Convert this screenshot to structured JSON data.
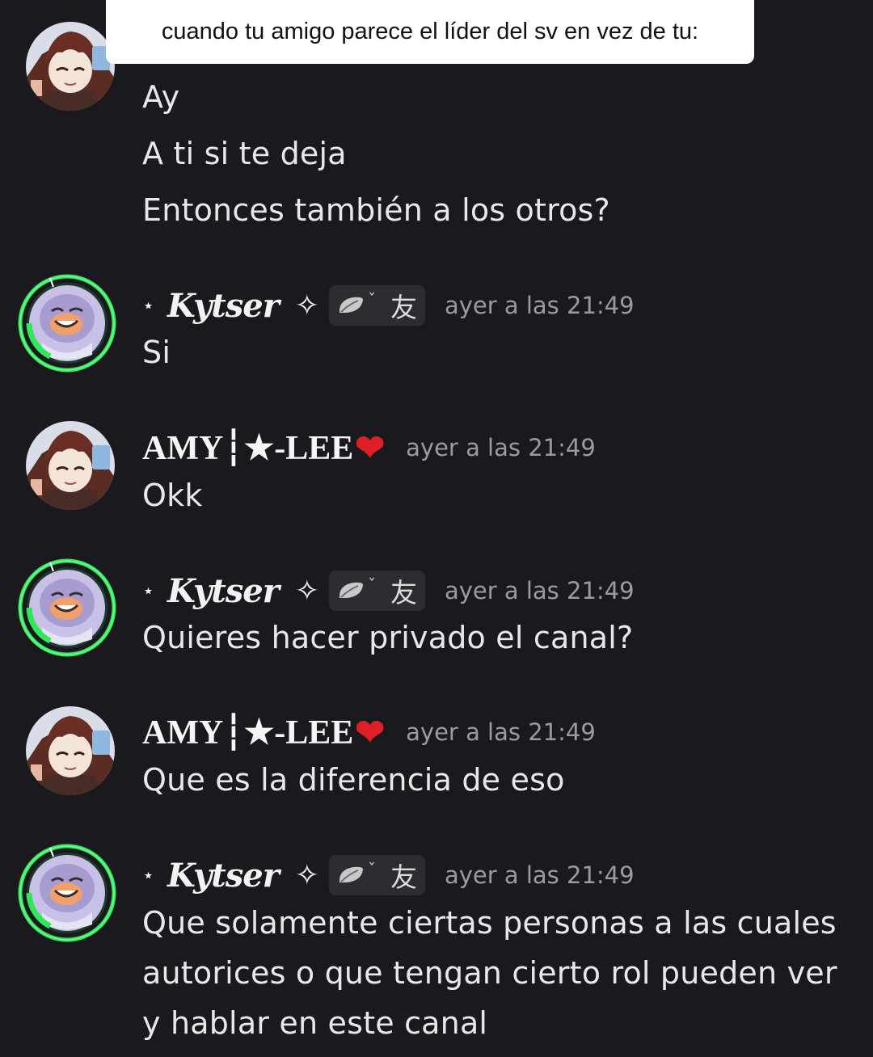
{
  "overlay_caption": "cuando tu amigo parece el líder del sv en vez de tu:",
  "top_lines": [
    "Ay",
    "A ti si te deja",
    "Entonces también a los otros?"
  ],
  "users": {
    "kytser": {
      "prefix": "⋆",
      "name": "Kytser",
      "badge": "✧",
      "tag_char": "友",
      "tag_mark": "ˇ",
      "ring_color": "#2ee85a"
    },
    "amy": {
      "name": "AMY┆★-LEE",
      "heart": "❤"
    }
  },
  "messages": [
    {
      "timestamp": "ayer a las 21:49",
      "lines": [
        "Si"
      ]
    },
    {
      "timestamp": "ayer a las 21:49",
      "lines": [
        "Okk"
      ]
    },
    {
      "timestamp": "ayer a las 21:49",
      "lines": [
        "Quieres hacer privado el canal?"
      ]
    },
    {
      "timestamp": "ayer a las 21:49",
      "lines": [
        "Que es la diferencia de eso"
      ]
    },
    {
      "timestamp": "ayer a las 21:49",
      "lines": [
        "Que solamente ciertas personas a las cuales",
        "autorices o que tengan cierto rol pueden ver",
        "y hablar en este canal"
      ]
    }
  ]
}
